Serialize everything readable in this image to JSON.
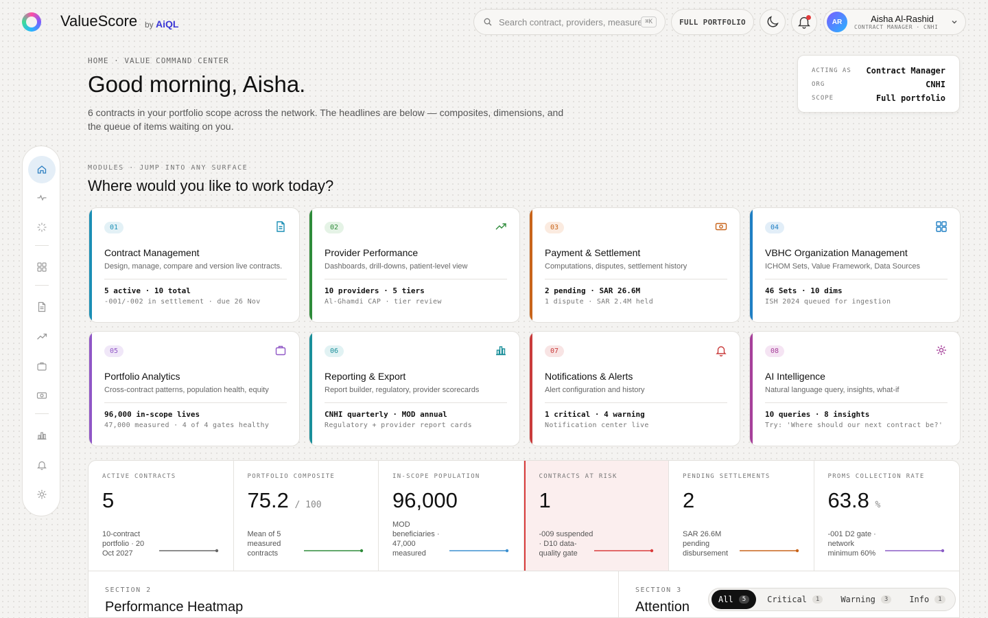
{
  "brand": {
    "name": "ValueScore",
    "by": "by",
    "company": "AiQL"
  },
  "search": {
    "placeholder": "Search contract, providers, measures",
    "shortcut": "⌘K"
  },
  "topbar": {
    "scope_button": "FULL PORTFOLIO"
  },
  "user": {
    "initials": "AR",
    "name": "Aisha Al-Rashid",
    "role": "CONTRACT MANAGER · CNHI"
  },
  "breadcrumb": "HOME · VALUE COMMAND CENTER",
  "greeting": "Good morning, Aisha.",
  "intro": "6 contracts in your portfolio scope across the network. The headlines are below — composites, dimensions, and the queue of items waiting on you.",
  "acting": {
    "rows": [
      {
        "key": "ACTING AS",
        "value": "Contract Manager"
      },
      {
        "key": "ORG",
        "value": "CNHI"
      },
      {
        "key": "SCOPE",
        "value": "Full portfolio"
      }
    ]
  },
  "modules": {
    "eyebrow": "MODULES · JUMP INTO ANY SURFACE",
    "title": "Where would you like to work today?",
    "cards": [
      {
        "num": "01",
        "title": "Contract Management",
        "desc": "Design, manage, compare and version live contracts.",
        "stat": "5 active · 10 total",
        "sub": "-001/-002 in settlement · due 26 Nov",
        "color": "#1b8fb5",
        "tint": "#e3f1f6",
        "icon": "document-icon"
      },
      {
        "num": "02",
        "title": "Provider Performance",
        "desc": "Dashboards, drill-downs, patient-level view",
        "stat": "10 providers · 5 tiers",
        "sub": "Al-Ghamdi CAP · tier review",
        "color": "#2e8b3a",
        "tint": "#e5f3e6",
        "icon": "trending-up-icon"
      },
      {
        "num": "03",
        "title": "Payment & Settlement",
        "desc": "Computations, disputes, settlement history",
        "stat": "2 pending · SAR 26.6M",
        "sub": "1 dispute · SAR 2.4M held",
        "color": "#c8641a",
        "tint": "#fbebe0",
        "icon": "banknote-icon"
      },
      {
        "num": "04",
        "title": "VBHC Organization Management",
        "desc": "ICHOM Sets, Value Framework, Data Sources",
        "stat": "46 Sets · 10 dims",
        "sub": "ISH 2024 queued for ingestion",
        "color": "#1f7fc4",
        "tint": "#e2eef8",
        "icon": "grid-icon"
      },
      {
        "num": "05",
        "title": "Portfolio Analytics",
        "desc": "Cross-contract patterns, population health, equity",
        "stat": "96,000 in-scope lives",
        "sub": "47,000 measured · 4 of 4 gates healthy",
        "color": "#9057c6",
        "tint": "#f0e7f8",
        "icon": "briefcase-icon"
      },
      {
        "num": "06",
        "title": "Reporting & Export",
        "desc": "Report builder, regulatory, provider scorecards",
        "stat": "CNHI quarterly · MOD annual",
        "sub": "Regulatory + provider report cards",
        "color": "#1a8f9a",
        "tint": "#e1f2f3",
        "icon": "bar-chart-icon"
      },
      {
        "num": "07",
        "title": "Notifications & Alerts",
        "desc": "Alert configuration and history",
        "stat": "1 critical · 4 warning",
        "sub": "Notification center live",
        "color": "#c93b3b",
        "tint": "#f8e4e4",
        "icon": "bell-icon"
      },
      {
        "num": "08",
        "title": "AI Intelligence",
        "desc": "Natural language query, insights, what-if",
        "stat": "10 queries · 8 insights",
        "sub": "Try: 'Where should our next contract be?'",
        "color": "#a63f9a",
        "tint": "#f5e4f3",
        "icon": "sparkle-icon"
      }
    ]
  },
  "kpis": [
    {
      "label": "ACTIVE CONTRACTS",
      "value": "5",
      "suffix": "",
      "foot": "10-contract portfolio · 20 Oct 2027",
      "color": "#666666"
    },
    {
      "label": "PORTFOLIO COMPOSITE",
      "value": "75.2",
      "suffix": "/ 100",
      "foot": "Mean of 5 measured contracts",
      "color": "#2e8b3a"
    },
    {
      "label": "IN-SCOPE POPULATION",
      "value": "96,000",
      "suffix": "",
      "foot": "MOD beneficiaries · 47,000 measured",
      "color": "#3b8fd0"
    },
    {
      "label": "CONTRACTS AT RISK",
      "value": "1",
      "suffix": "",
      "foot": "-009 suspended · D10 data-quality gate",
      "color": "#d93b3b"
    },
    {
      "label": "PENDING SETTLEMENTS",
      "value": "2",
      "suffix": "",
      "foot": "SAR 26.6M pending disbursement",
      "color": "#c8641a"
    },
    {
      "label": "PROMS COLLECTION RATE",
      "value": "63.8",
      "suffix": "%",
      "foot": "-001 D2 gate · network minimum 60%",
      "color": "#8a5cc6"
    }
  ],
  "sections": {
    "heatmap": {
      "eyebrow": "SECTION 2",
      "title": "Performance Heatmap"
    },
    "attention": {
      "eyebrow": "SECTION 3",
      "title": "Attention",
      "filters": [
        {
          "label": "All",
          "count": "5"
        },
        {
          "label": "Critical",
          "count": "1"
        },
        {
          "label": "Warning",
          "count": "3"
        },
        {
          "label": "Info",
          "count": "1"
        }
      ]
    }
  },
  "nav": {
    "items": [
      "home-icon",
      "activity-icon",
      "loader-icon",
      "grid-icon",
      "document-icon",
      "trending-up-icon",
      "briefcase-icon",
      "banknote-icon",
      "bar-chart-icon",
      "bell-icon",
      "sparkle-icon"
    ]
  }
}
